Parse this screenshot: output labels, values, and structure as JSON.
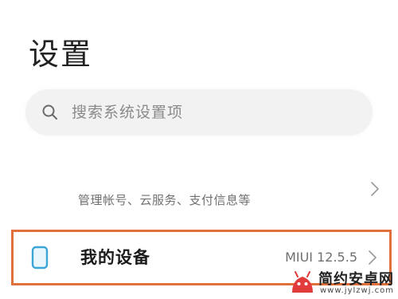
{
  "header": {
    "title": "设置"
  },
  "search": {
    "icon": "search-icon",
    "placeholder": "搜索系统设置项"
  },
  "account": {
    "description": "管理帐号、云服务、支付信息等",
    "icon": "chevron-right-icon"
  },
  "device": {
    "label": "我的设备",
    "version": "MIUI 12.5.5",
    "icon": "phone-icon",
    "highlight_color": "#e0703c",
    "icon_color": "#3aa6d8"
  },
  "watermark": {
    "brand": "简约安卓网",
    "url": "www.jylzwj.com",
    "logo_color": "#e23b3b"
  }
}
